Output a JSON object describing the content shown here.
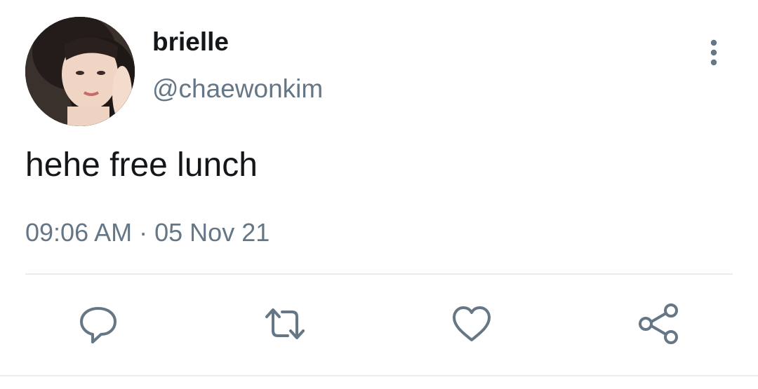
{
  "tweet": {
    "display_name": "brielle",
    "handle": "@chaewonkim",
    "text": "hehe free lunch",
    "time": "09:06 AM",
    "separator": "·",
    "date": "05 Nov 21"
  },
  "icons": {
    "more": "more-vertical-icon",
    "reply": "reply-icon",
    "retweet": "retweet-icon",
    "like": "heart-icon",
    "share": "share-icon"
  },
  "colors": {
    "primary_text": "#14171a",
    "secondary_text": "#657786",
    "icon": "#657786",
    "divider": "#e6ecf0"
  }
}
